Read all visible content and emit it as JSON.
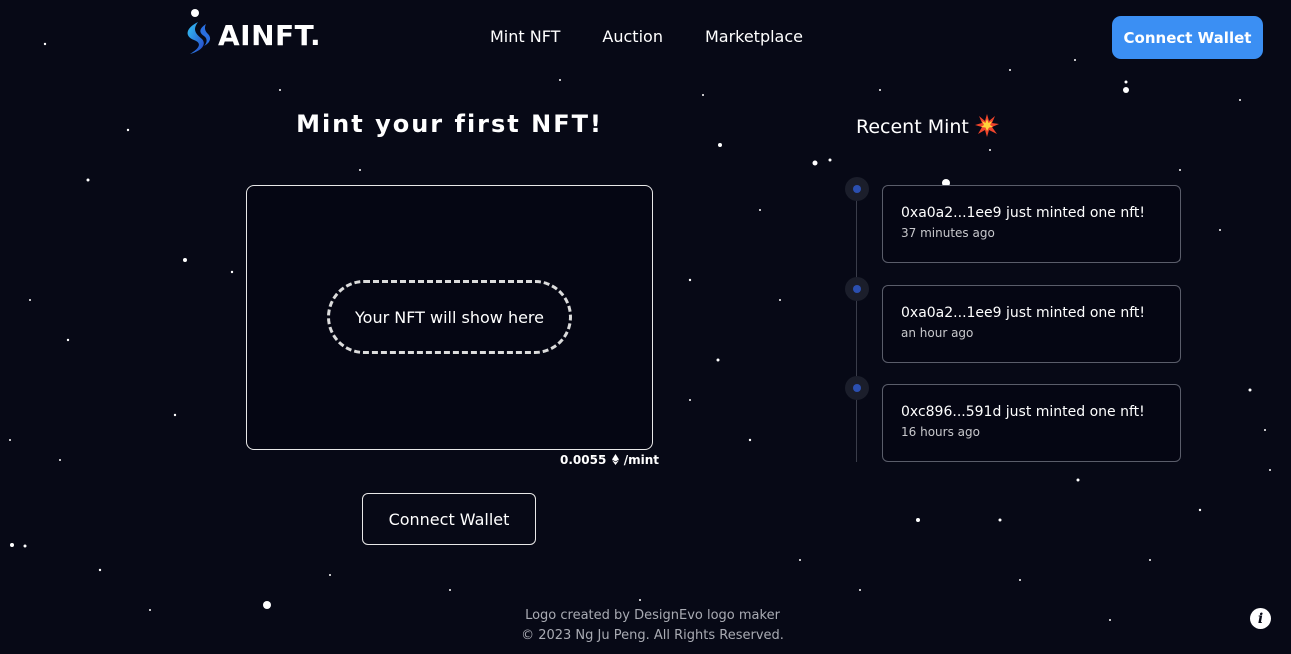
{
  "header": {
    "logo_text": "AINFT.",
    "nav": [
      "Mint NFT",
      "Auction",
      "Marketplace"
    ],
    "connect_label": "Connect Wallet"
  },
  "mint": {
    "title": "Mint your first NFT!",
    "placeholder": "Your NFT will show here",
    "price": "0.0055",
    "price_unit": "/mint",
    "currency_icon": "ethereum-icon",
    "button_label": "Connect Wallet"
  },
  "recent": {
    "title": "Recent Mint",
    "title_icon": "collision-icon",
    "items": [
      {
        "text": "0xa0a2...1ee9 just minted one nft!",
        "time": "37 minutes ago"
      },
      {
        "text": "0xa0a2...1ee9 just minted one nft!",
        "time": "an hour ago"
      },
      {
        "text": "0xc896...591d just minted one nft!",
        "time": "16 hours ago"
      }
    ]
  },
  "footer": {
    "line1": "Logo created by DesignEvo logo maker",
    "line2": "© 2023 Ng Ju Peng. All Rights Reserved."
  },
  "colors": {
    "background": "#070916",
    "accent": "#3b8ff3",
    "timeline_dot": "#2b4fb0"
  }
}
